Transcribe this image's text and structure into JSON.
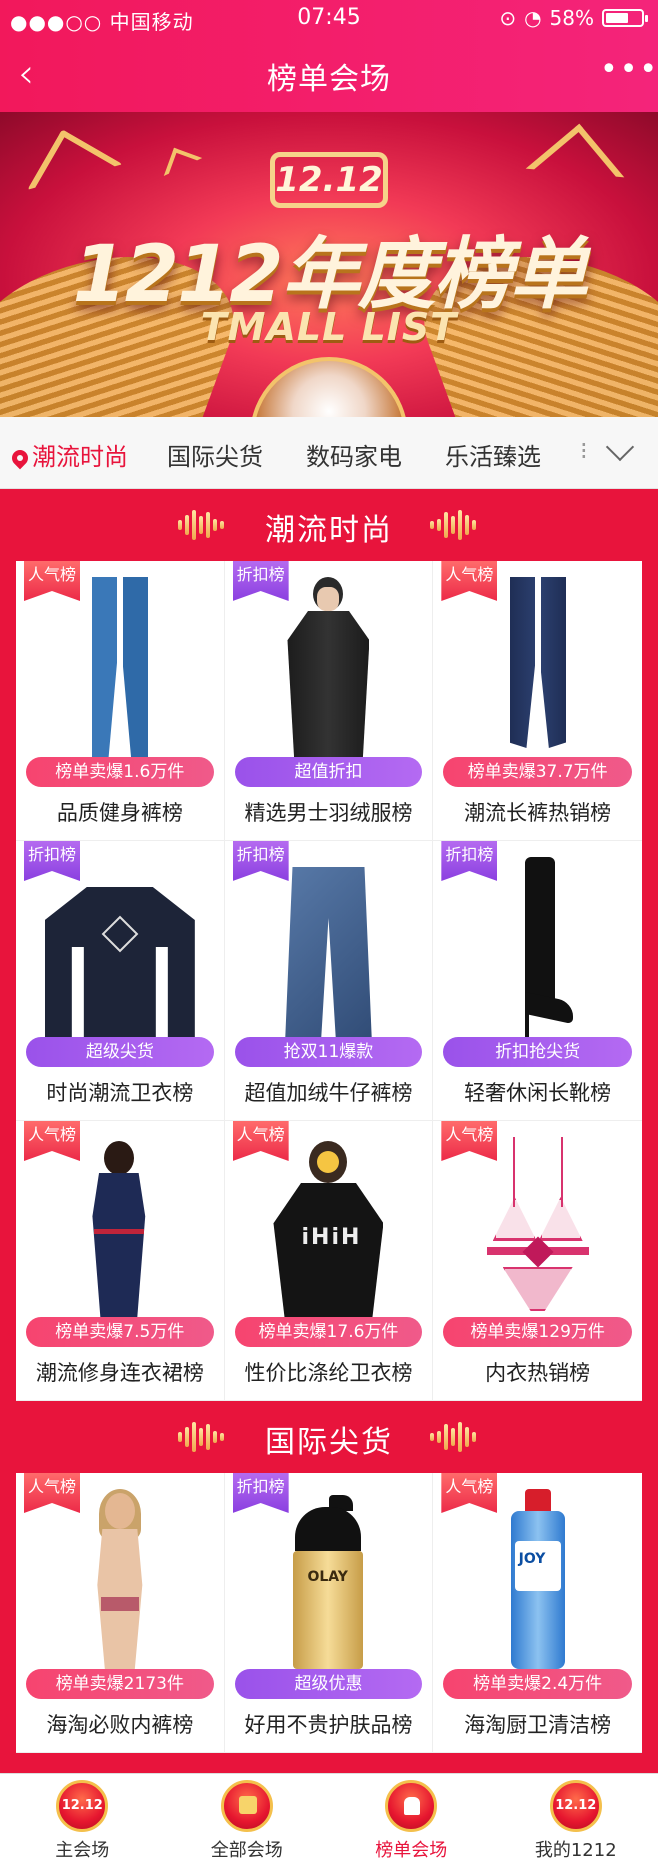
{
  "status_bar": {
    "carrier": "●●●○○ 中国移动",
    "time": "07:45",
    "battery": "58%"
  },
  "nav": {
    "back": "‹",
    "title": "榜单会场",
    "more": "•••"
  },
  "banner": {
    "badge": "12.12",
    "headline": "1212年度榜单",
    "subline": "TMALL LIST"
  },
  "tabs": {
    "items": [
      "潮流时尚",
      "国际尖货",
      "数码家电",
      "乐活臻选"
    ],
    "overflow": "⁝",
    "active_index": 0
  },
  "sections": [
    {
      "title": "潮流时尚",
      "products": [
        {
          "flag": "人气榜",
          "flag_type": "pop",
          "pill": "榜单卖爆1.6万件",
          "pill_type": "red",
          "name": "品质健身裤榜",
          "image": "leggings"
        },
        {
          "flag": "折扣榜",
          "flag_type": "disc",
          "pill": "超值折扣",
          "pill_type": "purple",
          "name": "精选男士羽绒服榜",
          "image": "coat"
        },
        {
          "flag": "人气榜",
          "flag_type": "pop",
          "pill": "榜单卖爆37.7万件",
          "pill_type": "red",
          "name": "潮流长裤热销榜",
          "image": "jeans"
        },
        {
          "flag": "折扣榜",
          "flag_type": "disc",
          "pill": "超级尖货",
          "pill_type": "purple",
          "name": "时尚潮流卫衣榜",
          "image": "sweatshirt"
        },
        {
          "flag": "折扣榜",
          "flag_type": "disc",
          "pill": "抢双11爆款",
          "pill_type": "purple",
          "name": "超值加绒牛仔裤榜",
          "image": "denim"
        },
        {
          "flag": "折扣榜",
          "flag_type": "disc",
          "pill": "折扣抢尖货",
          "pill_type": "purple",
          "name": "轻奢休闲长靴榜",
          "image": "boot"
        },
        {
          "flag": "人气榜",
          "flag_type": "pop",
          "pill": "榜单卖爆7.5万件",
          "pill_type": "red",
          "name": "潮流修身连衣裙榜",
          "image": "dress"
        },
        {
          "flag": "人气榜",
          "flag_type": "pop",
          "pill": "榜单卖爆17.6万件",
          "pill_type": "red",
          "name": "性价比涤纶卫衣榜",
          "image": "hoodie"
        },
        {
          "flag": "人气榜",
          "flag_type": "pop",
          "pill": "榜单卖爆129万件",
          "pill_type": "red",
          "name": "内衣热销榜",
          "image": "lingerie"
        }
      ]
    },
    {
      "title": "国际尖货",
      "products": [
        {
          "flag": "人气榜",
          "flag_type": "pop",
          "pill": "榜单卖爆2173件",
          "pill_type": "red",
          "name": "海淘必败内裤榜",
          "image": "model"
        },
        {
          "flag": "折扣榜",
          "flag_type": "disc",
          "pill": "超级优惠",
          "pill_type": "purple",
          "name": "好用不贵护肤品榜",
          "image": "cream",
          "brand": "OLAY"
        },
        {
          "flag": "人气榜",
          "flag_type": "pop",
          "pill": "榜单卖爆2.4万件",
          "pill_type": "red",
          "name": "海淘厨卫清洁榜",
          "image": "bottle",
          "brand": "JOY"
        }
      ]
    }
  ],
  "tabbar": {
    "items": [
      {
        "label": "主会场",
        "icon": "1212-badge-icon",
        "badge": "12.12"
      },
      {
        "label": "全部会场",
        "icon": "gift-box-icon",
        "badge": ""
      },
      {
        "label": "榜单会场",
        "icon": "thumbs-up-icon",
        "badge": ""
      },
      {
        "label": "我的1212",
        "icon": "1212-badge-icon",
        "badge": "12.12"
      }
    ],
    "active_index": 2
  },
  "colors": {
    "accent": "#e8143c",
    "pink_header": "#f2185b",
    "pill_red": "#f6446f",
    "pill_purple": "#9a52ea"
  }
}
